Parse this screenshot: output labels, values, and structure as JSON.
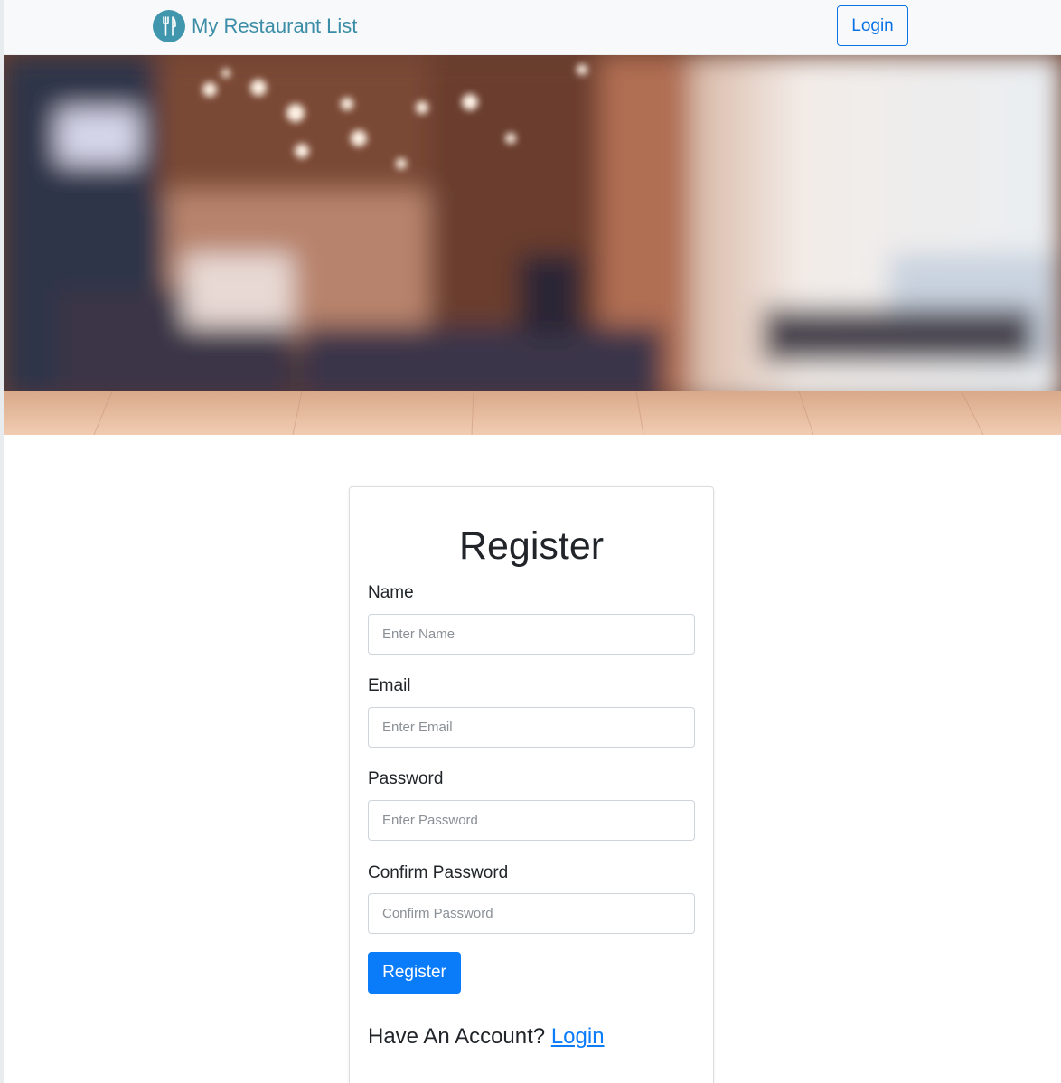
{
  "navbar": {
    "brand": "My Restaurant List",
    "brand_icon": "fork-knife-icon",
    "login_label": "Login"
  },
  "hero": {
    "image": "blurred restaurant interior with wooden table"
  },
  "form": {
    "title": "Register",
    "fields": [
      {
        "label": "Name",
        "placeholder": "Enter Name"
      },
      {
        "label": "Email",
        "placeholder": "Enter Email"
      },
      {
        "label": "Password",
        "placeholder": "Enter Password"
      },
      {
        "label": "Confirm Password",
        "placeholder": "Confirm Password"
      }
    ],
    "submit_label": "Register",
    "account_prompt": "Have An Account?",
    "account_link": "Login"
  },
  "colors": {
    "brand": "#3b8da7",
    "primary": "#0a7cf9",
    "navbar_bg": "#f8f9fa"
  }
}
